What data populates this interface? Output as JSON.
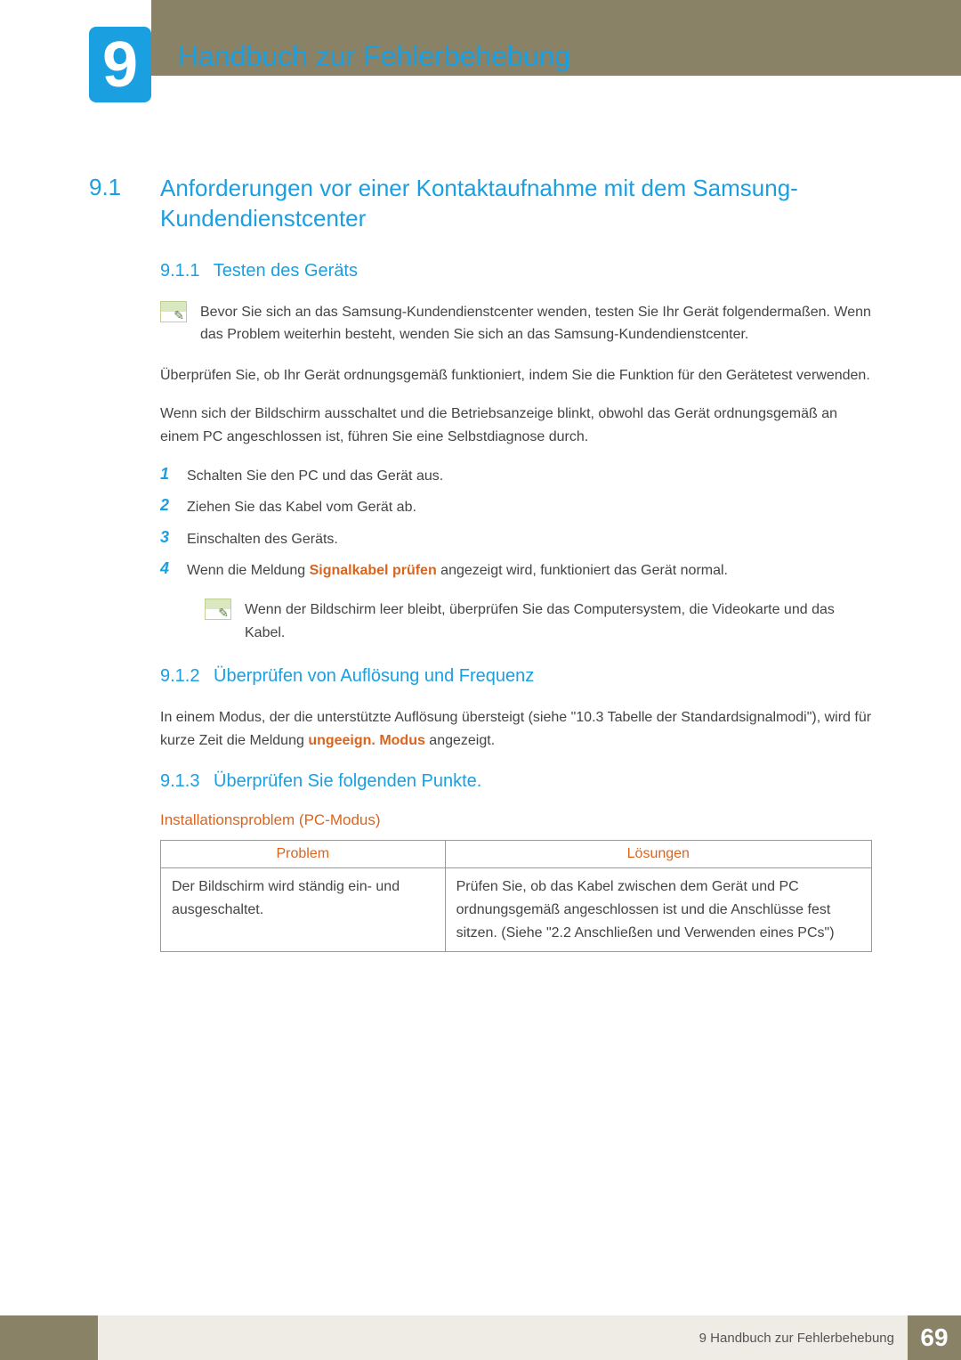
{
  "chapter": {
    "number": "9",
    "title": "Handbuch zur Fehlerbehebung"
  },
  "section": {
    "number": "9.1",
    "title": "Anforderungen vor einer Kontaktaufnahme mit dem Samsung-Kundendienstcenter"
  },
  "sub1": {
    "number": "9.1.1",
    "title": "Testen des Geräts",
    "note": "Bevor Sie sich an das Samsung-Kundendienstcenter wenden, testen Sie Ihr Gerät folgendermaßen. Wenn das Problem weiterhin besteht, wenden Sie sich an das Samsung-Kundendienstcenter.",
    "p1": "Überprüfen Sie, ob Ihr Gerät ordnungsgemäß funktioniert, indem Sie die Funktion für den Gerätetest verwenden.",
    "p2": "Wenn sich der Bildschirm ausschaltet und die Betriebsanzeige blinkt, obwohl das Gerät ordnungsgemäß an einem PC angeschlossen ist, führen Sie eine Selbstdiagnose durch.",
    "steps": [
      "Schalten Sie den PC und das Gerät aus.",
      "Ziehen Sie das Kabel vom Gerät ab.",
      "Einschalten des Geräts."
    ],
    "step4_before": "Wenn die Meldung ",
    "step4_emph": "Signalkabel prüfen",
    "step4_after": " angezeigt wird, funktioniert das Gerät normal.",
    "subnote": "Wenn der Bildschirm leer bleibt, überprüfen Sie das Computersystem, die Videokarte und das Kabel."
  },
  "sub2": {
    "number": "9.1.2",
    "title": "Überprüfen von Auflösung und Frequenz",
    "p_before": "In einem Modus, der die unterstützte Auflösung übersteigt (siehe \"10.3 Tabelle der Standardsignalmodi\"), wird für kurze Zeit die Meldung ",
    "p_emph": "ungeeign. Modus",
    "p_after": " angezeigt."
  },
  "sub3": {
    "number": "9.1.3",
    "title": "Überprüfen Sie folgenden Punkte.",
    "subhead": "Installationsproblem (PC-Modus)",
    "table": {
      "headers": [
        "Problem",
        "Lösungen"
      ],
      "rows": [
        {
          "problem": "Der Bildschirm wird ständig ein- und ausgeschaltet.",
          "solution": "Prüfen Sie, ob das Kabel zwischen dem Gerät und PC ordnungsgemäß angeschlossen ist und die Anschlüsse fest sitzen. (Siehe \"2.2 Anschließen und Verwenden eines PCs\")"
        }
      ]
    }
  },
  "footer": {
    "text": "9 Handbuch zur Fehlerbehebung",
    "page": "69"
  }
}
